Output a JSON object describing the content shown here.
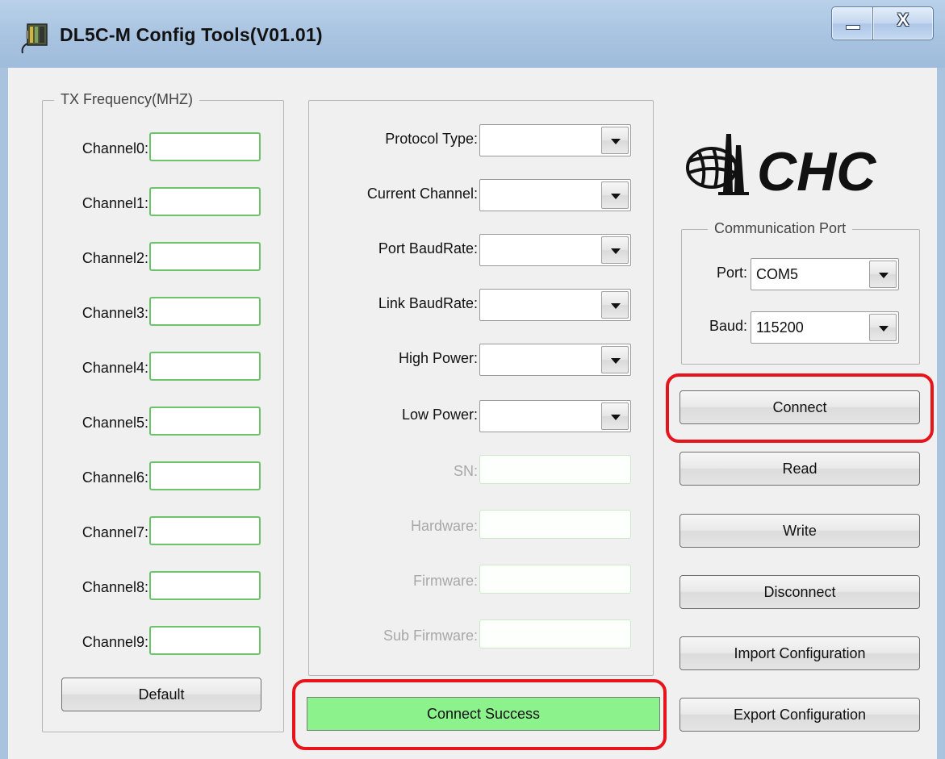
{
  "window": {
    "title": "DL5C-M Config Tools(V01.01)",
    "minimize_glyph": "_",
    "close_glyph": "X"
  },
  "tx_frequency": {
    "legend": "TX Frequency(MHZ)",
    "channels": [
      {
        "label": "Channel0:",
        "value": ""
      },
      {
        "label": "Channel1:",
        "value": ""
      },
      {
        "label": "Channel2:",
        "value": ""
      },
      {
        "label": "Channel3:",
        "value": ""
      },
      {
        "label": "Channel4:",
        "value": ""
      },
      {
        "label": "Channel5:",
        "value": ""
      },
      {
        "label": "Channel6:",
        "value": ""
      },
      {
        "label": "Channel7:",
        "value": ""
      },
      {
        "label": "Channel8:",
        "value": ""
      },
      {
        "label": "Channel9:",
        "value": ""
      }
    ],
    "default_button": "Default"
  },
  "settings": {
    "protocol_type": {
      "label": "Protocol Type:",
      "value": ""
    },
    "current_channel": {
      "label": "Current Channel:",
      "value": ""
    },
    "port_baudrate": {
      "label": "Port BaudRate:",
      "value": ""
    },
    "link_baudrate": {
      "label": "Link BaudRate:",
      "value": ""
    },
    "high_power": {
      "label": "High Power:",
      "value": ""
    },
    "low_power": {
      "label": "Low Power:",
      "value": ""
    },
    "sn": {
      "label": "SN:",
      "value": ""
    },
    "hardware": {
      "label": "Hardware:",
      "value": ""
    },
    "firmware": {
      "label": "Firmware:",
      "value": ""
    },
    "sub_firmware": {
      "label": "Sub Firmware:",
      "value": ""
    }
  },
  "status": {
    "text": "Connect Success",
    "color": "#8cf28c"
  },
  "logo": {
    "text": "CHC",
    "icon": "globe-antenna-logo"
  },
  "communication_port": {
    "legend": "Communication Port",
    "port": {
      "label": "Port:",
      "value": "COM5"
    },
    "baud": {
      "label": "Baud:",
      "value": "115200"
    }
  },
  "actions": {
    "connect": "Connect",
    "read": "Read",
    "write": "Write",
    "disconnect": "Disconnect",
    "import": "Import Configuration",
    "export": "Export Configuration"
  },
  "colors": {
    "highlight": "#e8141b",
    "field_border": "#6cc36c",
    "title_bar": "#a9c3df"
  }
}
